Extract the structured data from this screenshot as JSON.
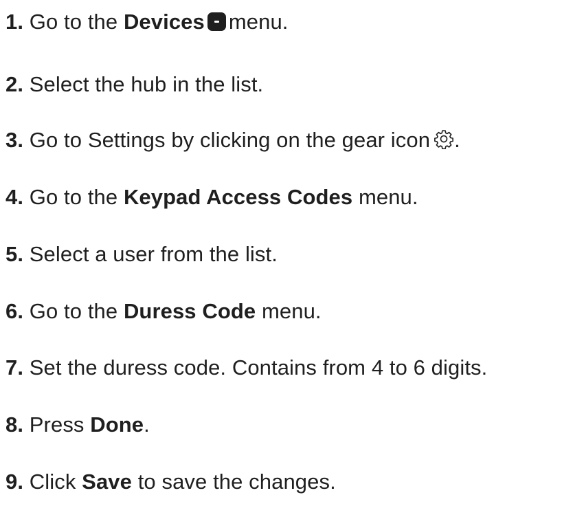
{
  "steps": [
    {
      "num": "1.",
      "before": "Go to the",
      "bold": "Devices",
      "after": "menu.",
      "icon": "devices-icon"
    },
    {
      "num": "2.",
      "text": "Select the hub in the list."
    },
    {
      "num": "3.",
      "text": "Go to Settings by clicking on the gear icon",
      "icon": "gear-icon",
      "end": "."
    },
    {
      "num": "4.",
      "before": "Go to the",
      "bold": "Keypad Access Codes",
      "after": "menu."
    },
    {
      "num": "5.",
      "text": "Select a user from the list."
    },
    {
      "num": "6.",
      "before": "Go to the",
      "bold": "Duress Code",
      "after": "menu."
    },
    {
      "num": "7.",
      "text": "Set the duress code. Contains from 4 to 6 digits."
    },
    {
      "num": "8.",
      "before": "Press",
      "bold": "Done",
      "end": "."
    },
    {
      "num": "9.",
      "before": "Click",
      "bold": "Save",
      "after": "to save the changes."
    }
  ]
}
